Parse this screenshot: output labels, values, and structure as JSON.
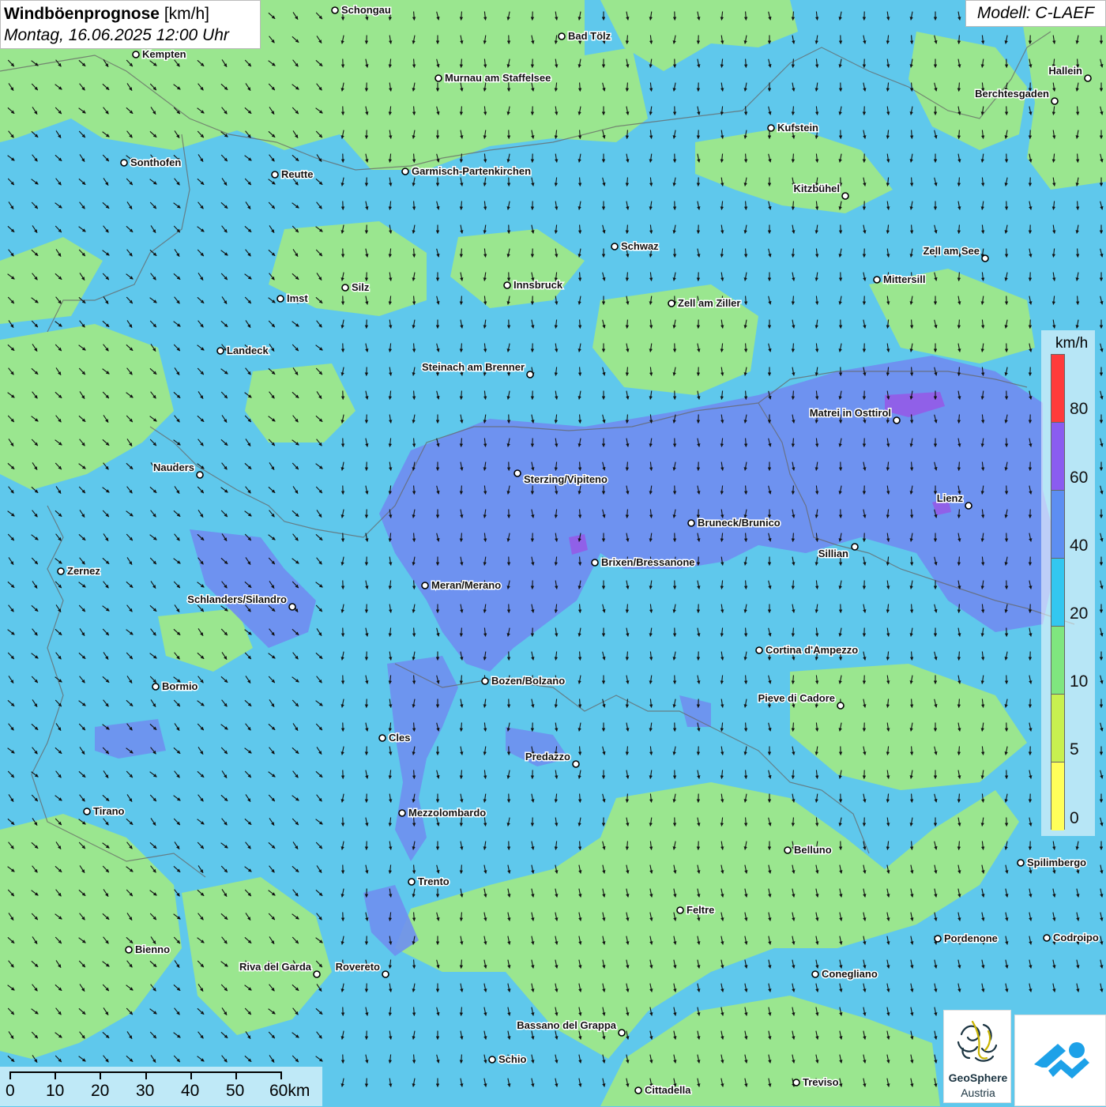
{
  "header": {
    "title_main": "Windböenprognose",
    "title_unit": "[km/h]",
    "date": "Montag, 16.06.2025 12:00 Uhr",
    "model": "Modell: C-LAEF"
  },
  "legend": {
    "unit": "km/h",
    "labels": [
      "80",
      "60",
      "40",
      "20",
      "10",
      "5",
      "0"
    ],
    "colors": [
      "#ff3b3b",
      "#8a5cf0",
      "#5d8ef2",
      "#33c7f0",
      "#7fe67f",
      "#c8f050",
      "#ffff5a"
    ]
  },
  "scale": {
    "labels": [
      "0",
      "10",
      "20",
      "30",
      "40",
      "50",
      "60km"
    ]
  },
  "logos": {
    "geosphere_name": "GeoSphere",
    "geosphere_sub": "Austria"
  },
  "colors": {
    "zone_10": "#9ae68f",
    "zone_20": "#5fc8ec",
    "zone_40": "#6f8ff0",
    "zone_60": "#9060e8",
    "arrow": "#111111",
    "border": "#555555"
  },
  "arrows": {
    "direction": "mostly southward, southeast in the west",
    "icon": "wind-arrow-icon"
  },
  "cities": [
    {
      "name": "Schongau"
    },
    {
      "name": "Bad Tölz"
    },
    {
      "name": "Kempten"
    },
    {
      "name": "Murnau am Staffelsee"
    },
    {
      "name": "Hallein"
    },
    {
      "name": "Berchtesgaden"
    },
    {
      "name": "Kufstein"
    },
    {
      "name": "Sonthofen"
    },
    {
      "name": "Reutte"
    },
    {
      "name": "Garmisch-Partenkirchen"
    },
    {
      "name": "Kitzbühel"
    },
    {
      "name": "Schwaz"
    },
    {
      "name": "Zell am See"
    },
    {
      "name": "Mittersill"
    },
    {
      "name": "Innsbruck"
    },
    {
      "name": "Silz"
    },
    {
      "name": "Imst"
    },
    {
      "name": "Zell am Ziller"
    },
    {
      "name": "Landeck"
    },
    {
      "name": "Steinach am Brenner"
    },
    {
      "name": "Matrei in Osttirol"
    },
    {
      "name": "Nauders"
    },
    {
      "name": "Sterzing/Vipiteno"
    },
    {
      "name": "Lienz"
    },
    {
      "name": "Bruneck/Brunico"
    },
    {
      "name": "Sillian"
    },
    {
      "name": "Zernez"
    },
    {
      "name": "Brixen/Bressanone"
    },
    {
      "name": "Meran/Merano"
    },
    {
      "name": "Schlanders/Silandro"
    },
    {
      "name": "Cortina d'Ampezzo"
    },
    {
      "name": "Bozen/Bolzano"
    },
    {
      "name": "Bormio"
    },
    {
      "name": "Pieve di Cadore"
    },
    {
      "name": "Cles"
    },
    {
      "name": "Predazzo"
    },
    {
      "name": "Tirano"
    },
    {
      "name": "Mezzolombardo"
    },
    {
      "name": "Belluno"
    },
    {
      "name": "Spilimbergo"
    },
    {
      "name": "Trento"
    },
    {
      "name": "Feltre"
    },
    {
      "name": "Bienno"
    },
    {
      "name": "Pordenone"
    },
    {
      "name": "Codroipo"
    },
    {
      "name": "Riva del Garda"
    },
    {
      "name": "Rovereto"
    },
    {
      "name": "Conegliano"
    },
    {
      "name": "Bassano del Grappa"
    },
    {
      "name": "Schio"
    },
    {
      "name": "Treviso"
    },
    {
      "name": "Cittadella"
    }
  ]
}
